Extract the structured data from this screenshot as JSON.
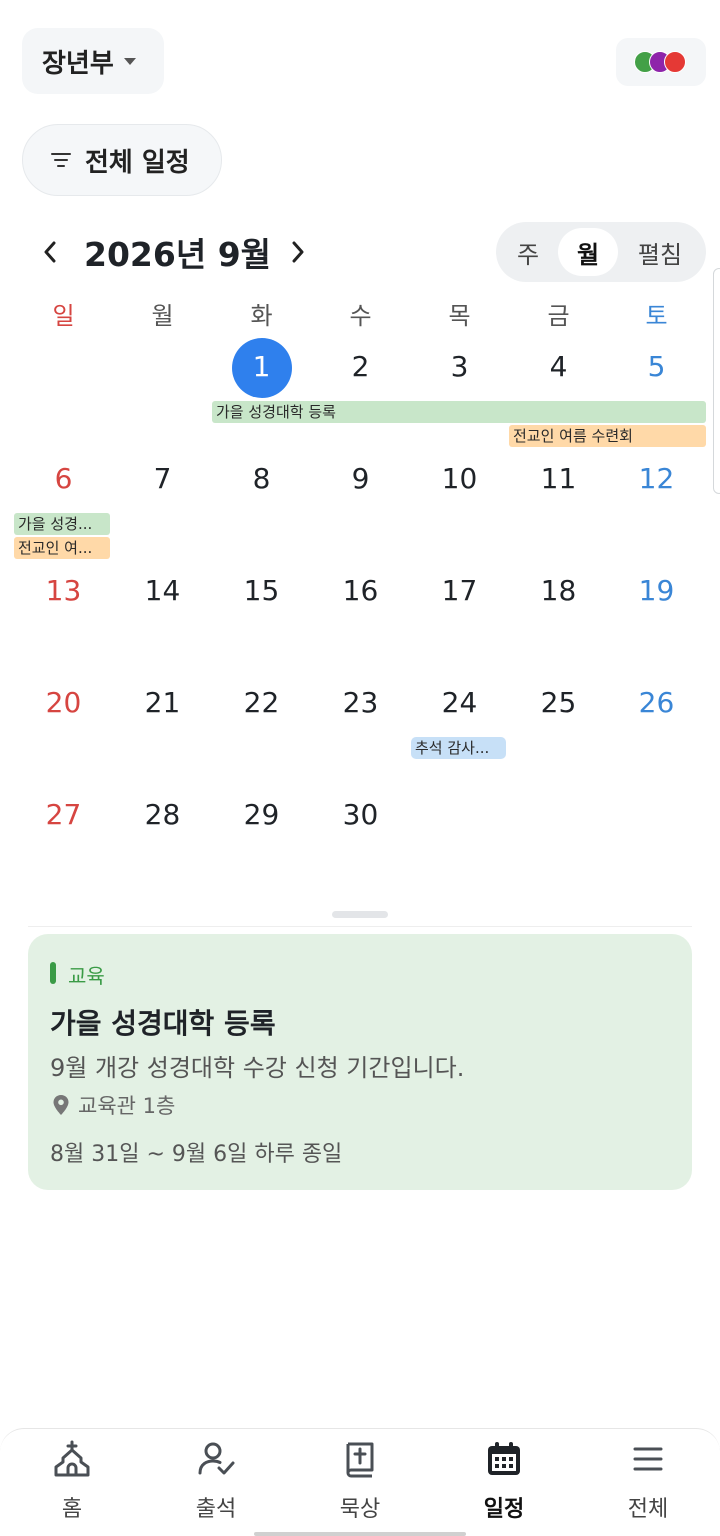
{
  "header": {
    "group_name": "장년부",
    "colors": [
      "#43a047",
      "#8e24aa",
      "#e53935"
    ]
  },
  "filter": {
    "label": "전체 일정"
  },
  "calendar": {
    "month_title": "2026년 9월",
    "view_modes": [
      "주",
      "월",
      "펼침"
    ],
    "active_view": "월",
    "weekdays": [
      "일",
      "월",
      "화",
      "수",
      "목",
      "금",
      "토"
    ],
    "weeks": [
      [
        "",
        "",
        "1",
        "2",
        "3",
        "4",
        "5"
      ],
      [
        "6",
        "7",
        "8",
        "9",
        "10",
        "11",
        "12"
      ],
      [
        "13",
        "14",
        "15",
        "16",
        "17",
        "18",
        "19"
      ],
      [
        "20",
        "21",
        "22",
        "23",
        "24",
        "25",
        "26"
      ],
      [
        "27",
        "28",
        "29",
        "30",
        "",
        "",
        ""
      ]
    ],
    "today": "1",
    "events": {
      "week1_green": "가을 성경대학 등록",
      "week1_orange": "전교인 여름 수련회",
      "week2_green": "가을 성경...",
      "week2_orange": "전교인 여...",
      "week4_blue": "추석 감사..."
    },
    "event_colors": {
      "green": "#c8e6c9",
      "orange": "#ffd9a8",
      "blue": "#c7e0f7"
    }
  },
  "detail": {
    "category": "교육",
    "title": "가을 성경대학 등록",
    "description": "9월 개강 성경대학 수강 신청 기간입니다.",
    "location": "교육관 1층",
    "date_range": "8월 31일 ~ 9월 6일 하루 종일"
  },
  "bottom_nav": {
    "tabs": [
      {
        "label": "홈",
        "icon": "church-icon"
      },
      {
        "label": "출석",
        "icon": "person-check-icon"
      },
      {
        "label": "묵상",
        "icon": "bible-icon"
      },
      {
        "label": "일정",
        "icon": "calendar-icon"
      },
      {
        "label": "전체",
        "icon": "menu-icon"
      }
    ],
    "active": "일정"
  }
}
